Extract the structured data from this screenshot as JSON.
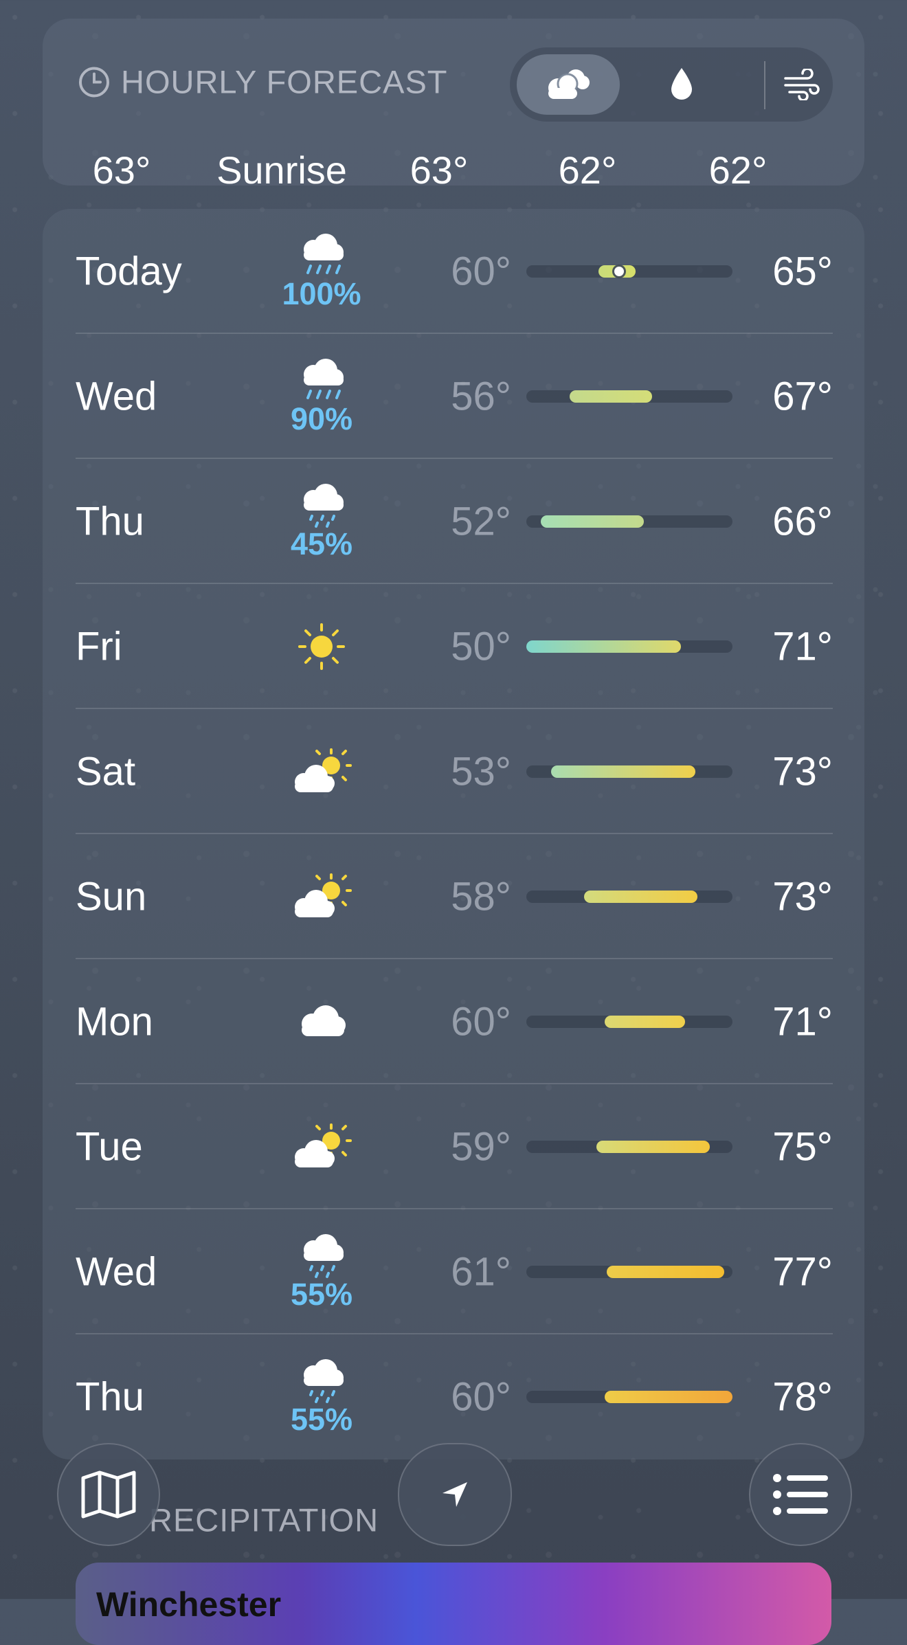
{
  "hourly": {
    "title": "HOURLY FORECAST",
    "tabs": [
      "conditions",
      "precipitation",
      "wind"
    ],
    "active_tab": "conditions",
    "items": [
      "63°",
      "Sunrise",
      "63°",
      "62°",
      "62°"
    ]
  },
  "days": [
    {
      "day": "Today",
      "icon": "cloud-rain-icon",
      "pct": "100%",
      "low": "60°",
      "high": "65°",
      "range": [
        0.35,
        0.53
      ],
      "current": 0.45,
      "colors": [
        "#c9dc7a",
        "#d7df6a"
      ]
    },
    {
      "day": "Wed",
      "icon": "cloud-rain-icon",
      "pct": "90%",
      "low": "56°",
      "high": "67°",
      "range": [
        0.21,
        0.61
      ],
      "colors": [
        "#c4d98c",
        "#d4dd78"
      ]
    },
    {
      "day": "Thu",
      "icon": "cloud-drizzle-icon",
      "pct": "45%",
      "low": "52°",
      "high": "66°",
      "range": [
        0.07,
        0.57
      ],
      "colors": [
        "#a6dfb4",
        "#c4d98c"
      ]
    },
    {
      "day": "Fri",
      "icon": "sun-icon",
      "pct": "",
      "low": "50°",
      "high": "71°",
      "range": [
        0.0,
        0.75
      ],
      "colors": [
        "#7fd6cc",
        "#e0d86a"
      ]
    },
    {
      "day": "Sat",
      "icon": "partly-sunny-icon",
      "pct": "",
      "low": "53°",
      "high": "73°",
      "range": [
        0.12,
        0.82
      ],
      "colors": [
        "#a9dcb0",
        "#f0d04c"
      ]
    },
    {
      "day": "Sun",
      "icon": "partly-sunny-icon",
      "pct": "",
      "low": "58°",
      "high": "73°",
      "range": [
        0.28,
        0.83
      ],
      "colors": [
        "#d3db7e",
        "#f2cc44"
      ]
    },
    {
      "day": "Mon",
      "icon": "cloud-icon",
      "pct": "",
      "low": "60°",
      "high": "71°",
      "range": [
        0.38,
        0.77
      ],
      "colors": [
        "#dcd872",
        "#f0d04c"
      ]
    },
    {
      "day": "Tue",
      "icon": "partly-sunny-icon",
      "pct": "",
      "low": "59°",
      "high": "75°",
      "range": [
        0.34,
        0.89
      ],
      "colors": [
        "#d8da78",
        "#f4c63c"
      ]
    },
    {
      "day": "Wed",
      "icon": "cloud-drizzle-icon",
      "pct": "55%",
      "low": "61°",
      "high": "77°",
      "range": [
        0.39,
        0.96
      ],
      "colors": [
        "#edcc4a",
        "#f4bd30"
      ]
    },
    {
      "day": "Thu",
      "icon": "cloud-drizzle-icon",
      "pct": "55%",
      "low": "60°",
      "high": "78°",
      "range": [
        0.38,
        1.0
      ],
      "colors": [
        "#efcc48",
        "#f2a63a"
      ]
    }
  ],
  "precipitation_label": "RECIPITATION",
  "map_city": "Winchester",
  "toolbar": [
    "map-icon",
    "location-arrow-icon",
    "list-icon"
  ]
}
